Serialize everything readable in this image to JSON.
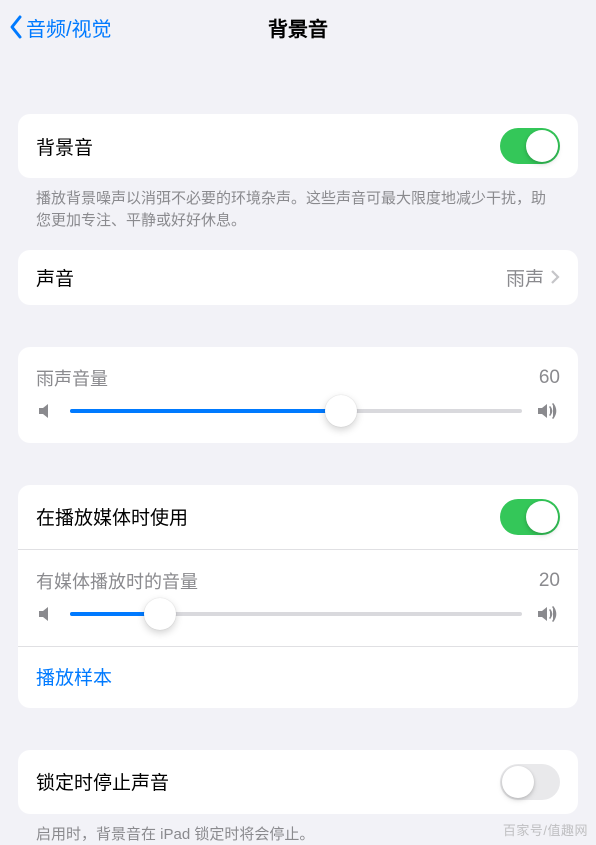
{
  "nav": {
    "back": "音频/视觉",
    "title": "背景音"
  },
  "section1": {
    "row_label": "背景音",
    "toggle_on": true,
    "footer": "播放背景噪声以消弭不必要的环境杂声。这些声音可最大限度地减少干扰，助您更加专注、平静或好好休息。"
  },
  "section2": {
    "label": "声音",
    "value": "雨声"
  },
  "section3": {
    "label": "雨声音量",
    "value": 60,
    "percent": 60
  },
  "section4": {
    "row1_label": "在播放媒体时使用",
    "row1_on": true,
    "slider_label": "有媒体播放时的音量",
    "slider_value": 20,
    "slider_percent": 20,
    "link": "播放样本"
  },
  "section5": {
    "label": "锁定时停止声音",
    "toggle_on": false,
    "footer": "启用时，背景音在 iPad 锁定时将会停止。"
  },
  "watermark": "百家号/值趣网"
}
